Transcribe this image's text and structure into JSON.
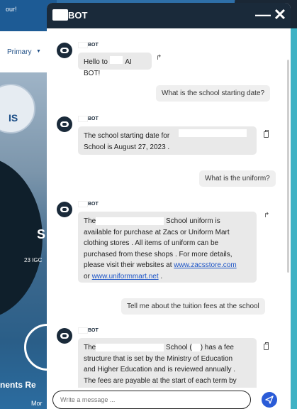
{
  "background": {
    "topbar_text": "our!",
    "nav_text": "Primary",
    "logo_text": "IS",
    "hero_letter": "S",
    "hero_subtext": "23 IGC",
    "events_text": "nents Re",
    "more_text": "Mor"
  },
  "header": {
    "title": "BOT"
  },
  "bot_label": "BOT",
  "messages": [
    {
      "type": "bot",
      "text": "Hello to         AI BOT!"
    },
    {
      "type": "user",
      "text": "What is the school starting date?"
    },
    {
      "type": "bot",
      "line1": "The school starting date for",
      "line2": "School is August 27, 2023 ."
    },
    {
      "type": "user",
      "text": "What is the uniform?"
    },
    {
      "type": "bot",
      "line1_a": "The",
      "line1_b": "School uniform is",
      "line2": "available for purchase at Zacs or Uniform Mart",
      "line3": "clothing stores . All items of uniform can be",
      "line4": "purchased from these shops . For more details,",
      "line5_a": "please visit their websites at",
      "link1": "www.zacsstore.com",
      "line6_a": "or",
      "link2": "www.uniformmart.net",
      "line6_b": "."
    },
    {
      "type": "user",
      "text": "Tell me about the tuition fees at the school"
    },
    {
      "type": "bot",
      "line1_a": "The",
      "line1_b": "School (",
      "line1_c": ") has a fee",
      "line2": "structure that is set by the Ministry of Education",
      "line3": "and Higher Education and is reviewed annually .",
      "line4": "The fees are payable at the start of each term by"
    }
  ],
  "input": {
    "placeholder": "Write a message ..."
  }
}
